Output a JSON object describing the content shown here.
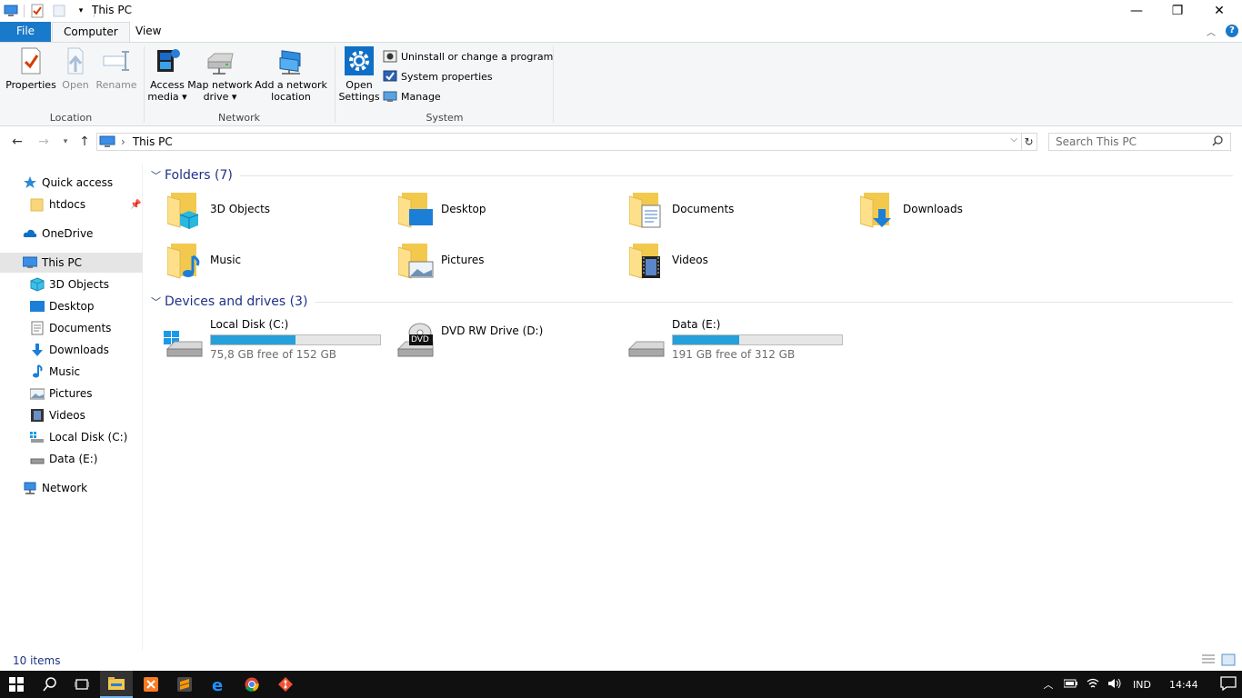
{
  "window": {
    "title": "This PC",
    "controls": {
      "minimize": "—",
      "restore": "❐",
      "close": "✕"
    }
  },
  "ribbon": {
    "tabs": {
      "file": "File",
      "computer": "Computer",
      "view": "View"
    },
    "groups": {
      "location": {
        "label": "Location",
        "properties": "Properties",
        "open": "Open",
        "rename": "Rename"
      },
      "network": {
        "label": "Network",
        "access_media_1": "Access",
        "access_media_2": "media ▾",
        "map_drive_1": "Map network",
        "map_drive_2": "drive ▾",
        "add_location_1": "Add a network",
        "add_location_2": "location"
      },
      "system": {
        "label": "System",
        "open_settings_1": "Open",
        "open_settings_2": "Settings",
        "uninstall": "Uninstall or change a program",
        "system_properties": "System properties",
        "manage": "Manage"
      }
    }
  },
  "address_bar": {
    "path": "This PC",
    "separator": "›",
    "search_placeholder": "Search This PC"
  },
  "nav_pane": {
    "quick_access": "Quick access",
    "htdocs": "htdocs",
    "onedrive": "OneDrive",
    "this_pc": "This PC",
    "objects3d": "3D Objects",
    "desktop": "Desktop",
    "documents": "Documents",
    "downloads": "Downloads",
    "music": "Music",
    "pictures": "Pictures",
    "videos": "Videos",
    "local_disk": "Local Disk (C:)",
    "data": "Data (E:)",
    "network": "Network"
  },
  "content": {
    "folders_header": "Folders (7)",
    "folders": {
      "objects3d": "3D Objects",
      "desktop": "Desktop",
      "documents": "Documents",
      "downloads": "Downloads",
      "music": "Music",
      "pictures": "Pictures",
      "videos": "Videos"
    },
    "drives_header": "Devices and drives (3)",
    "drives": {
      "c": {
        "name": "Local Disk (C:)",
        "free": "75,8 GB free of 152 GB",
        "used_fraction": 0.5
      },
      "d": {
        "name": "DVD RW Drive (D:)",
        "badge": "DVD"
      },
      "e": {
        "name": "Data (E:)",
        "free": "191 GB free of 312 GB",
        "used_fraction": 0.39
      }
    }
  },
  "status_bar": {
    "items": "10 items"
  },
  "taskbar": {
    "language": "IND",
    "time": "14:44"
  },
  "colors": {
    "accent": "#1979ca",
    "drive_bar": "#26a0da",
    "folder": "#f9d67a",
    "taskbar": "#101010"
  }
}
